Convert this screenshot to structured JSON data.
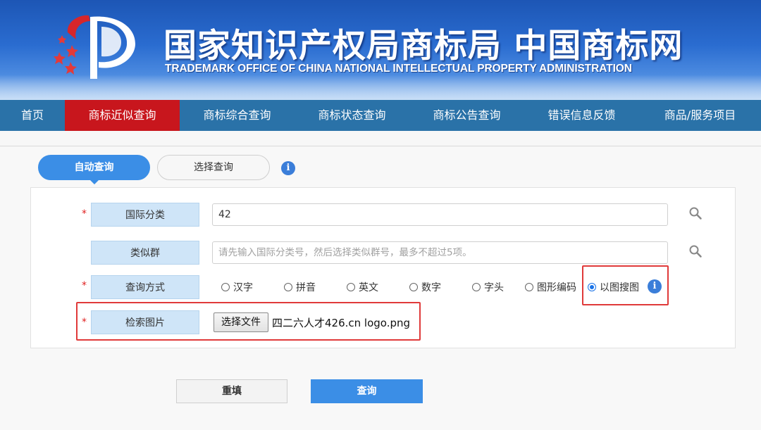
{
  "header": {
    "title_cn": "国家知识产权局商标局 中国商标网",
    "title_en": "TRADEMARK OFFICE OF CHINA NATIONAL INTELLECTUAL PROPERTY ADMINISTRATION"
  },
  "nav": {
    "items": [
      "首页",
      "商标近似查询",
      "商标综合查询",
      "商标状态查询",
      "商标公告查询",
      "错误信息反馈",
      "商品/服务项目"
    ],
    "active_index": 1
  },
  "tabs": {
    "auto": "自动查询",
    "select": "选择查询",
    "active": "自动查询"
  },
  "form": {
    "required_mark": "*",
    "intl_class": {
      "label": "国际分类",
      "value": "42"
    },
    "similar_group": {
      "label": "类似群",
      "placeholder": "请先输入国际分类号，然后选择类似群号，最多不超过5项。"
    },
    "query_method": {
      "label": "查询方式",
      "options": [
        "汉字",
        "拼音",
        "英文",
        "数字",
        "字头",
        "图形编码",
        "以图搜图"
      ],
      "selected": "以图搜图"
    },
    "search_image": {
      "label": "检索图片",
      "button": "选择文件",
      "file_name": "四二六人才426.cn logo.png"
    }
  },
  "actions": {
    "reset": "重填",
    "search": "查询"
  },
  "icons": {
    "logo": "cnipa-emblem-icon",
    "info": "info-icon",
    "search": "search-icon"
  },
  "colors": {
    "banner": "#2a6cd0",
    "nav": "#2a72a8",
    "nav_active": "#c8161d",
    "accent": "#3b8ee6",
    "highlight": "#e03a3a",
    "label_bg": "#cfe5f8"
  }
}
